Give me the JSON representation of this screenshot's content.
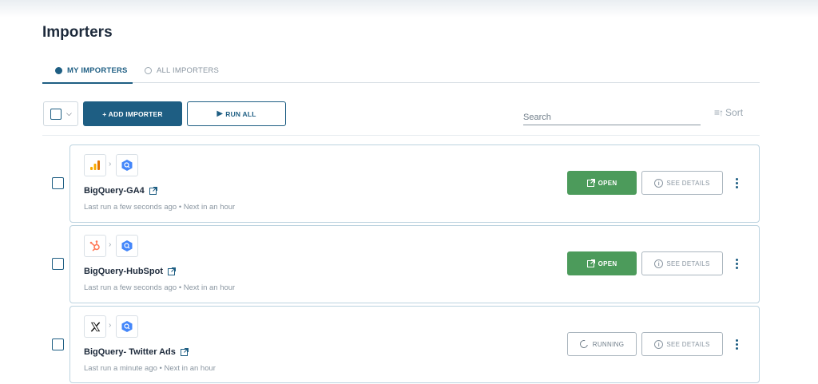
{
  "page": {
    "title": "Importers"
  },
  "tabs": [
    {
      "label": "MY IMPORTERS",
      "active": true
    },
    {
      "label": "ALL IMPORTERS",
      "active": false
    }
  ],
  "toolbar": {
    "add_label": "+ ADD IMPORTER",
    "run_label": "RUN ALL",
    "search_placeholder": "Search",
    "sort_label": "Sort"
  },
  "importers": [
    {
      "name": "BigQuery-GA4",
      "meta": "Last run a few seconds ago • Next in an hour",
      "source_icon": "google-analytics-icon",
      "destination_icon": "bigquery-icon",
      "primary_action": "OPEN",
      "status": "ready",
      "details_label": "SEE DETAILS"
    },
    {
      "name": "BigQuery-HubSpot",
      "meta": "Last run a few seconds ago • Next in an hour",
      "source_icon": "hubspot-icon",
      "destination_icon": "bigquery-icon",
      "primary_action": "OPEN",
      "status": "ready",
      "details_label": "SEE DETAILS"
    },
    {
      "name": "BigQuery- Twitter Ads",
      "meta": "Last run a minute ago • Next in an hour",
      "source_icon": "x-twitter-icon",
      "destination_icon": "bigquery-icon",
      "primary_action": "RUNNING",
      "status": "running",
      "details_label": "SEE DETAILS"
    }
  ],
  "colors": {
    "primary": "#1e5e83",
    "open_green": "#4c9b5b",
    "card_border": "#bcd3e0",
    "text_dark": "#1d2a3b",
    "text_muted": "#8a96a1"
  }
}
